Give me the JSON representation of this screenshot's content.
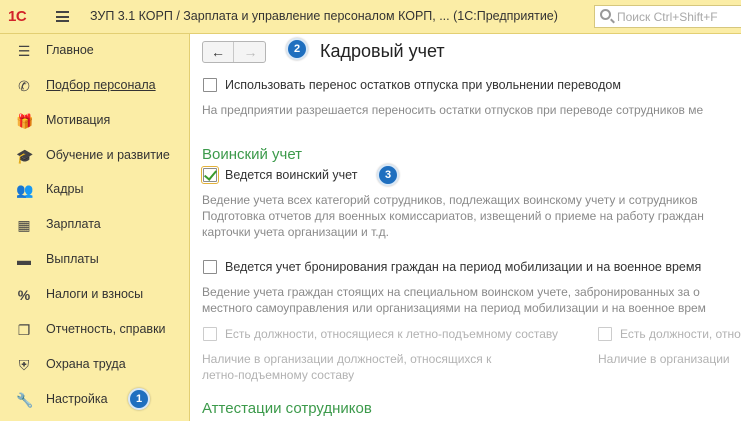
{
  "header": {
    "logo": "1С",
    "title": "ЗУП 3.1 КОРП / Зарплата и управление персоналом КОРП, ...   (1С:Предприятие)",
    "search_placeholder": "Поиск Ctrl+Shift+F"
  },
  "sidebar": {
    "items": [
      {
        "label": "Главное",
        "icon": "menu-lines-icon"
      },
      {
        "label": "Подбор персонала",
        "icon": "phone-icon"
      },
      {
        "label": "Мотивация",
        "icon": "gift-icon"
      },
      {
        "label": "Обучение и развитие",
        "icon": "graduation-cap-icon"
      },
      {
        "label": "Кадры",
        "icon": "people-icon"
      },
      {
        "label": "Зарплата",
        "icon": "calculator-icon"
      },
      {
        "label": "Выплаты",
        "icon": "banknote-icon"
      },
      {
        "label": "Налоги и взносы",
        "icon": "percent-icon"
      },
      {
        "label": "Отчетность, справки",
        "icon": "documents-icon"
      },
      {
        "label": "Охрана труда",
        "icon": "shield-icon"
      },
      {
        "label": "Настройка",
        "icon": "wrench-icon"
      }
    ]
  },
  "badges": {
    "b1": "1",
    "b2": "2",
    "b3": "3"
  },
  "content": {
    "title": "Кадровый учет",
    "transfer_checkbox": "Использовать перенос остатков отпуска при увольнении переводом",
    "transfer_desc": "На предприятии разрешается переносить остатки отпусков при переводе сотрудников ме",
    "military_section": "Воинский учет",
    "military_checkbox": "Ведется воинский учет",
    "military_desc_1": "Ведение учета всех категорий сотрудников, подлежащих воинскому учету и сотрудников",
    "military_desc_2": "Подготовка отчетов для военных комиссариатов, извещений о приеме на работу граждан",
    "military_desc_3": "карточки учета организации и т.д.",
    "reserve_checkbox": "Ведется учет бронирования граждан на период мобилизации и на военное время",
    "reserve_desc_1": "Ведение учета граждан стоящих на специальном воинском учете, забронированных за о",
    "reserve_desc_2": "местного самоуправления или организациями на период мобилизации и на военное врем",
    "flight_checkbox_1": "Есть должности, относящиеся к летно-подъемному составу",
    "flight_checkbox_2": "Есть должности, относящиеся",
    "flight_desc_1a": "Наличие в организации должностей, относящихся к",
    "flight_desc_1b": "летно-подъемному составу",
    "flight_desc_2": "Наличие в организации",
    "attest_section": "Аттестации сотрудников"
  },
  "colors": {
    "sidebar_bg": "#fbeda6",
    "section_green": "#3c9a4b",
    "badge_blue": "#1f6fbf",
    "check_green": "#3a9a2e"
  }
}
